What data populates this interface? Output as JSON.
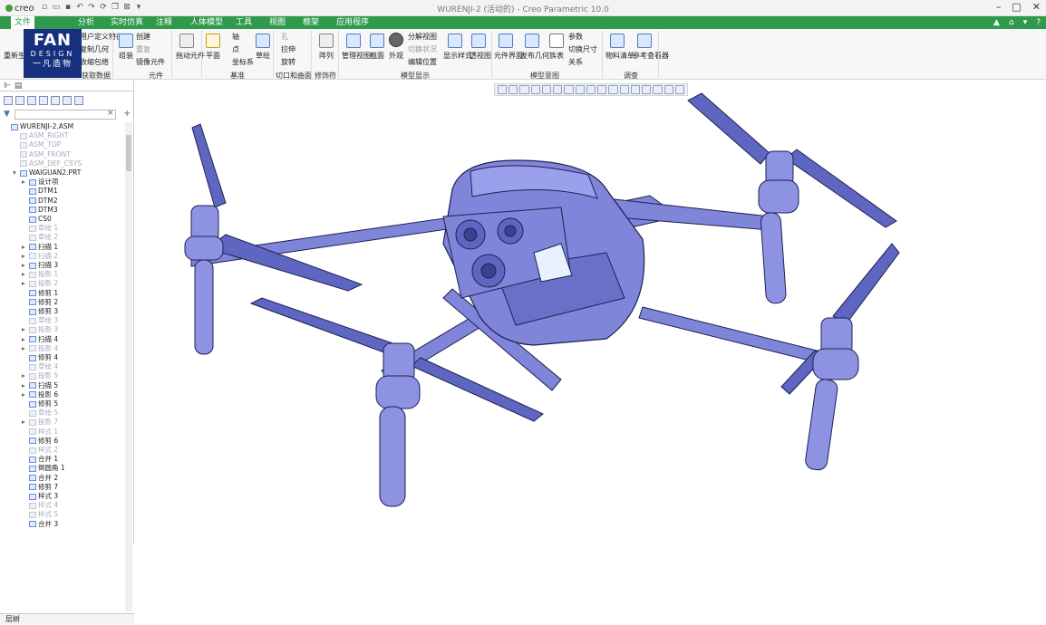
{
  "app": {
    "logo": "creo",
    "window_title": "WURENJI-2 (活动的) - Creo Parametric 10.0",
    "window_controls": [
      "–",
      "□",
      "✕"
    ]
  },
  "quick_access_icons": [
    "new-icon",
    "open-icon",
    "save-icon",
    "undo-icon",
    "redo-icon",
    "regenerate-icon",
    "windows-icon",
    "close-window-icon",
    "customize-icon"
  ],
  "tabs": [
    {
      "label": "文件",
      "active": true
    },
    {
      "label": "分析"
    },
    {
      "label": "实时仿真"
    },
    {
      "label": "注释"
    },
    {
      "label": "人体模型"
    },
    {
      "label": "工具"
    },
    {
      "label": "视图"
    },
    {
      "label": "框架"
    },
    {
      "label": "应用程序"
    }
  ],
  "tab_controls": [
    "▲",
    "⌂",
    "▾",
    "?"
  ],
  "brand_overlay": {
    "line1": "FAN",
    "line2": "DESIGN",
    "line3": "一凡造物"
  },
  "ribbon": {
    "regenerate": "重新生成",
    "user_defined_feature": "用户定义特征",
    "copy_geometry": "复制几何",
    "shrinkwrap": "收缩包络",
    "get_data_group": "获取数据",
    "assemble": "组装",
    "create": "创建",
    "repeat": "重复",
    "mirror_component": "镜像元件",
    "component_group": "元件",
    "drag_components": "拖动元件",
    "plane": "平面",
    "axis": "轴",
    "point": "点",
    "csys": "坐标系",
    "sketch": "草绘",
    "datum_group": "基准",
    "hole": "孔",
    "extrude": "拉伸",
    "revolve": "旋转",
    "cut_surface_group": "切口和曲面",
    "pattern": "阵列",
    "modifiers_group": "修饰符",
    "manage_views": "管理视图",
    "section": "截面",
    "appearance": "外观",
    "explode_view": "分解视图",
    "toggle_status": "切换状况",
    "edit_position": "编辑位置",
    "display_style": "显示样式",
    "perspective": "透视图",
    "model_display_group": "模型显示",
    "component_interface": "元件界面",
    "publish_geometry": "发布几何",
    "family_table": "族表",
    "parameters": "参数",
    "switch_dimensions": "切换尺寸",
    "relations": "关系",
    "model_intent_group": "模型意图",
    "bill_of_materials": "物料清单",
    "reference_viewer": "参考查看器",
    "investigate_group": "调查"
  },
  "model_tree": {
    "filter_placeholder": "",
    "items": [
      {
        "label": "WURENJI-2.ASM",
        "depth": 0,
        "expand": "",
        "suppressed": false
      },
      {
        "label": "ASM_RIGHT",
        "depth": 1,
        "expand": "",
        "suppressed": true
      },
      {
        "label": "ASM_TOP",
        "depth": 1,
        "expand": "",
        "suppressed": true
      },
      {
        "label": "ASM_FRONT",
        "depth": 1,
        "expand": "",
        "suppressed": true
      },
      {
        "label": "ASM_DEF_CSYS",
        "depth": 1,
        "expand": "",
        "suppressed": true
      },
      {
        "label": "WAIGUAN2.PRT",
        "depth": 1,
        "expand": "▾",
        "suppressed": false
      },
      {
        "label": "设计项",
        "depth": 2,
        "expand": "▸",
        "suppressed": false
      },
      {
        "label": "DTM1",
        "depth": 2,
        "expand": "",
        "suppressed": false
      },
      {
        "label": "DTM2",
        "depth": 2,
        "expand": "",
        "suppressed": false
      },
      {
        "label": "DTM3",
        "depth": 2,
        "expand": "",
        "suppressed": false
      },
      {
        "label": "CS0",
        "depth": 2,
        "expand": "",
        "suppressed": false
      },
      {
        "label": "草绘 1",
        "depth": 2,
        "expand": "",
        "suppressed": true
      },
      {
        "label": "草绘 2",
        "depth": 2,
        "expand": "",
        "suppressed": true
      },
      {
        "label": "扫描 1",
        "depth": 2,
        "expand": "▸",
        "suppressed": false
      },
      {
        "label": "扫描 2",
        "depth": 2,
        "expand": "▸",
        "suppressed": true
      },
      {
        "label": "扫描 3",
        "depth": 2,
        "expand": "▸",
        "suppressed": false
      },
      {
        "label": "投影 1",
        "depth": 2,
        "expand": "▸",
        "suppressed": true
      },
      {
        "label": "投影 2",
        "depth": 2,
        "expand": "▸",
        "suppressed": true
      },
      {
        "label": "修剪 1",
        "depth": 2,
        "expand": "",
        "suppressed": false
      },
      {
        "label": "修剪 2",
        "depth": 2,
        "expand": "",
        "suppressed": false
      },
      {
        "label": "修剪 3",
        "depth": 2,
        "expand": "",
        "suppressed": false
      },
      {
        "label": "草绘 3",
        "depth": 2,
        "expand": "",
        "suppressed": true
      },
      {
        "label": "投影 3",
        "depth": 2,
        "expand": "▸",
        "suppressed": true
      },
      {
        "label": "扫描 4",
        "depth": 2,
        "expand": "▸",
        "suppressed": false
      },
      {
        "label": "投影 4",
        "depth": 2,
        "expand": "▸",
        "suppressed": true
      },
      {
        "label": "修剪 4",
        "depth": 2,
        "expand": "",
        "suppressed": false
      },
      {
        "label": "草绘 4",
        "depth": 2,
        "expand": "",
        "suppressed": true
      },
      {
        "label": "投影 5",
        "depth": 2,
        "expand": "▸",
        "suppressed": true
      },
      {
        "label": "扫描 5",
        "depth": 2,
        "expand": "▸",
        "suppressed": false
      },
      {
        "label": "投影 6",
        "depth": 2,
        "expand": "▸",
        "suppressed": false
      },
      {
        "label": "修剪 5",
        "depth": 2,
        "expand": "",
        "suppressed": false
      },
      {
        "label": "草绘 5",
        "depth": 2,
        "expand": "",
        "suppressed": true
      },
      {
        "label": "投影 7",
        "depth": 2,
        "expand": "▸",
        "suppressed": true
      },
      {
        "label": "样式 1",
        "depth": 2,
        "expand": "",
        "suppressed": true
      },
      {
        "label": "修剪 6",
        "depth": 2,
        "expand": "",
        "suppressed": false
      },
      {
        "label": "样式 2",
        "depth": 2,
        "expand": "",
        "suppressed": true
      },
      {
        "label": "合并 1",
        "depth": 2,
        "expand": "",
        "suppressed": false
      },
      {
        "label": "倒圆角 1",
        "depth": 2,
        "expand": "",
        "suppressed": false
      },
      {
        "label": "合并 2",
        "depth": 2,
        "expand": "",
        "suppressed": false
      },
      {
        "label": "修剪 7",
        "depth": 2,
        "expand": "",
        "suppressed": false
      },
      {
        "label": "样式 3",
        "depth": 2,
        "expand": "",
        "suppressed": false
      },
      {
        "label": "样式 4",
        "depth": 2,
        "expand": "",
        "suppressed": true
      },
      {
        "label": "样式 5",
        "depth": 2,
        "expand": "",
        "suppressed": true
      },
      {
        "label": "合并 3",
        "depth": 2,
        "expand": "",
        "suppressed": false
      }
    ]
  },
  "layer_tree_label": "层树",
  "colors": {
    "tab_green": "#2f9a4b",
    "model_fill": "#7f85d9",
    "model_dark": "#4a4f9e",
    "model_line": "#1e2050"
  }
}
